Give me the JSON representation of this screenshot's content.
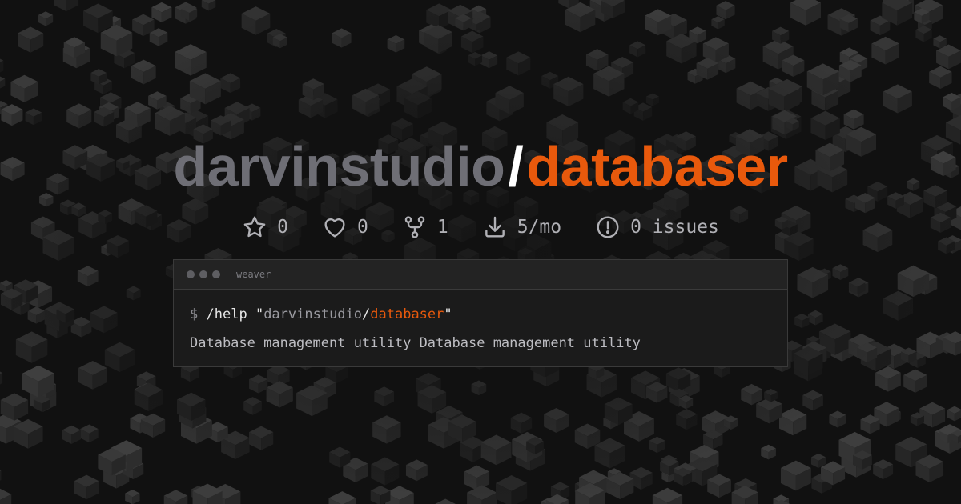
{
  "repo": {
    "owner": "darvinstudio",
    "separator": "/",
    "name": "databaser"
  },
  "stats": [
    {
      "icon": "star-icon",
      "value": "0"
    },
    {
      "icon": "heart-icon",
      "value": "0"
    },
    {
      "icon": "fork-icon",
      "value": "1"
    },
    {
      "icon": "download-icon",
      "value": "5/mo"
    },
    {
      "icon": "issue-icon",
      "value": "0 issues"
    }
  ],
  "terminal": {
    "window_name": "weaver",
    "prompt": "$",
    "command": "/help",
    "quote_open": "\"",
    "quote_owner": "darvinstudio",
    "quote_separator": "/",
    "quote_repo": "databaser",
    "quote_close": "\"",
    "output": "Database management utility Database management utility"
  },
  "colors": {
    "background": "#111111",
    "owner": "#6e6e75",
    "slash": "#ffffff",
    "accent": "#e8590c",
    "stat_text": "#b0b0b5",
    "terminal_bg": "#1b1b1b"
  }
}
